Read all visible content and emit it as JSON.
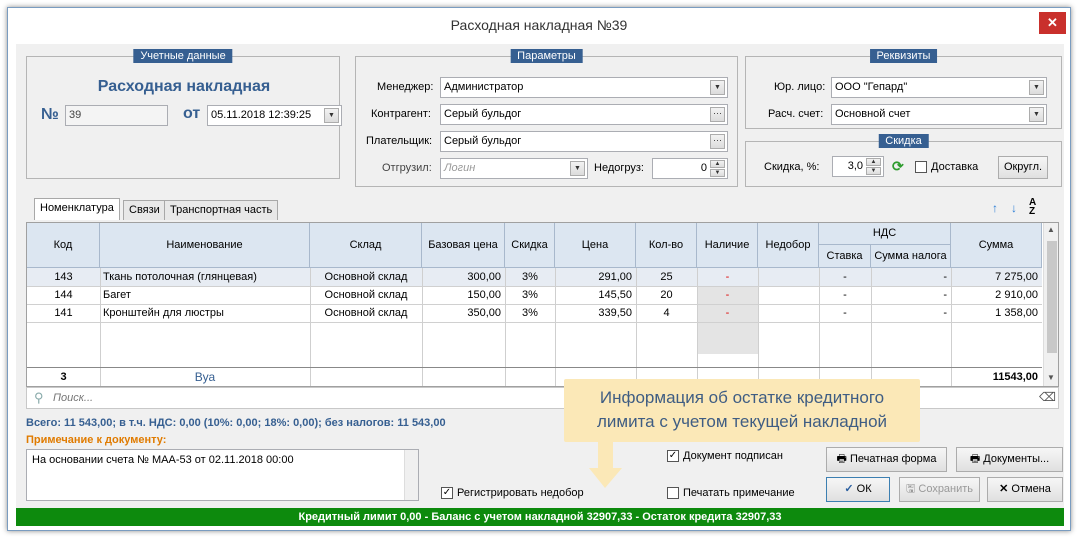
{
  "window": {
    "title": "Расходная накладная №39"
  },
  "accounting": {
    "caption": "Учетные данные",
    "heading": "Расходная накладная",
    "no_label": "№",
    "number": "39",
    "from_label": "от",
    "date": "05.11.2018 12:39:25"
  },
  "params": {
    "caption": "Параметры",
    "manager_label": "Менеджер:",
    "manager_value": "Администратор",
    "counterparty_label": "Контрагент:",
    "counterparty_value": "Серый бульдог",
    "payer_label": "Плательщик:",
    "payer_value": "Серый бульдог",
    "shipped_label": "Отгрузил:",
    "shipped_placeholder": "Логин",
    "shortfall_label": "Недогруз:",
    "shortfall_value": "0"
  },
  "requisites": {
    "caption": "Реквизиты",
    "legal_label": "Юр. лицо:",
    "legal_value": "ООО \"Гепард\"",
    "account_label": "Расч. счет:",
    "account_value": "Основной счет"
  },
  "discount": {
    "caption": "Скидка",
    "label": "Скидка, %:",
    "value": "3,0",
    "delivery_label": "Доставка",
    "delivery_checked": false,
    "round_label": "Округл."
  },
  "tabs": [
    {
      "label": "Номенклатура",
      "active": true
    },
    {
      "label": "Связи",
      "active": false
    },
    {
      "label": "Транспортная часть",
      "active": false
    }
  ],
  "table": {
    "headers": {
      "code": "Код",
      "name": "Наименование",
      "warehouse": "Склад",
      "base_price": "Базовая цена",
      "discount": "Скидка",
      "price": "Цена",
      "qty": "Кол-во",
      "availability": "Наличие",
      "shortage": "Недобор",
      "vat": "НДС",
      "vat_rate": "Ставка",
      "vat_amount": "Сумма налога",
      "sum": "Сумма"
    },
    "rows": [
      {
        "code": "143",
        "name": "Ткань потолочная (глянцевая)",
        "warehouse": "Основной склад",
        "base_price": "300,00",
        "discount": "3%",
        "price": "291,00",
        "qty": "25",
        "availability": "-",
        "shortage": "",
        "vat_rate": "-",
        "vat_amount": "-",
        "sum": "7 275,00"
      },
      {
        "code": "144",
        "name": "Багет",
        "warehouse": "Основной склад",
        "base_price": "150,00",
        "discount": "3%",
        "price": "145,50",
        "qty": "20",
        "availability": "-",
        "shortage": "",
        "vat_rate": "-",
        "vat_amount": "-",
        "sum": "2 910,00"
      },
      {
        "code": "141",
        "name": "Кронштейн для люстры",
        "warehouse": "Основной склад",
        "base_price": "350,00",
        "discount": "3%",
        "price": "339,50",
        "qty": "4",
        "availability": "-",
        "shortage": "",
        "vat_rate": "-",
        "vat_amount": "-",
        "sum": "1 358,00"
      }
    ],
    "footer": {
      "count": "3",
      "label": "Вуа",
      "total": "11543,00"
    }
  },
  "search": {
    "placeholder": "Поиск..."
  },
  "totals_line": "Всего: 11 543,00; в т.ч. НДС: 0,00 (10%: 0,00; 18%: 0,00); без налогов: 11 543,00",
  "note": {
    "label": "Примечание к документу:",
    "text": "На основании счета № МАА-53 от 02.11.2018 00:00"
  },
  "checks": {
    "register_shortage": "Регистрировать недобор",
    "signed": "Документ подписан",
    "print_note": "Печатать примечание"
  },
  "buttons": {
    "print_form": "Печатная форма",
    "documents": "Документы...",
    "ok": "ОК",
    "save": "Сохранить",
    "cancel": "Отмена"
  },
  "tooltip": {
    "line1": "Информация об остатке кредитного",
    "line2": "лимита с учетом текущей накладной"
  },
  "status": "Кредитный лимит 0,00  -  Баланс с учетом накладной 32907,33  -  Остаток кредита 32907,33",
  "colors": {
    "accent": "#365f91",
    "status_bar": "#0d8a0d",
    "note_label": "#e07b00",
    "header_bg": "#dce6f1"
  }
}
